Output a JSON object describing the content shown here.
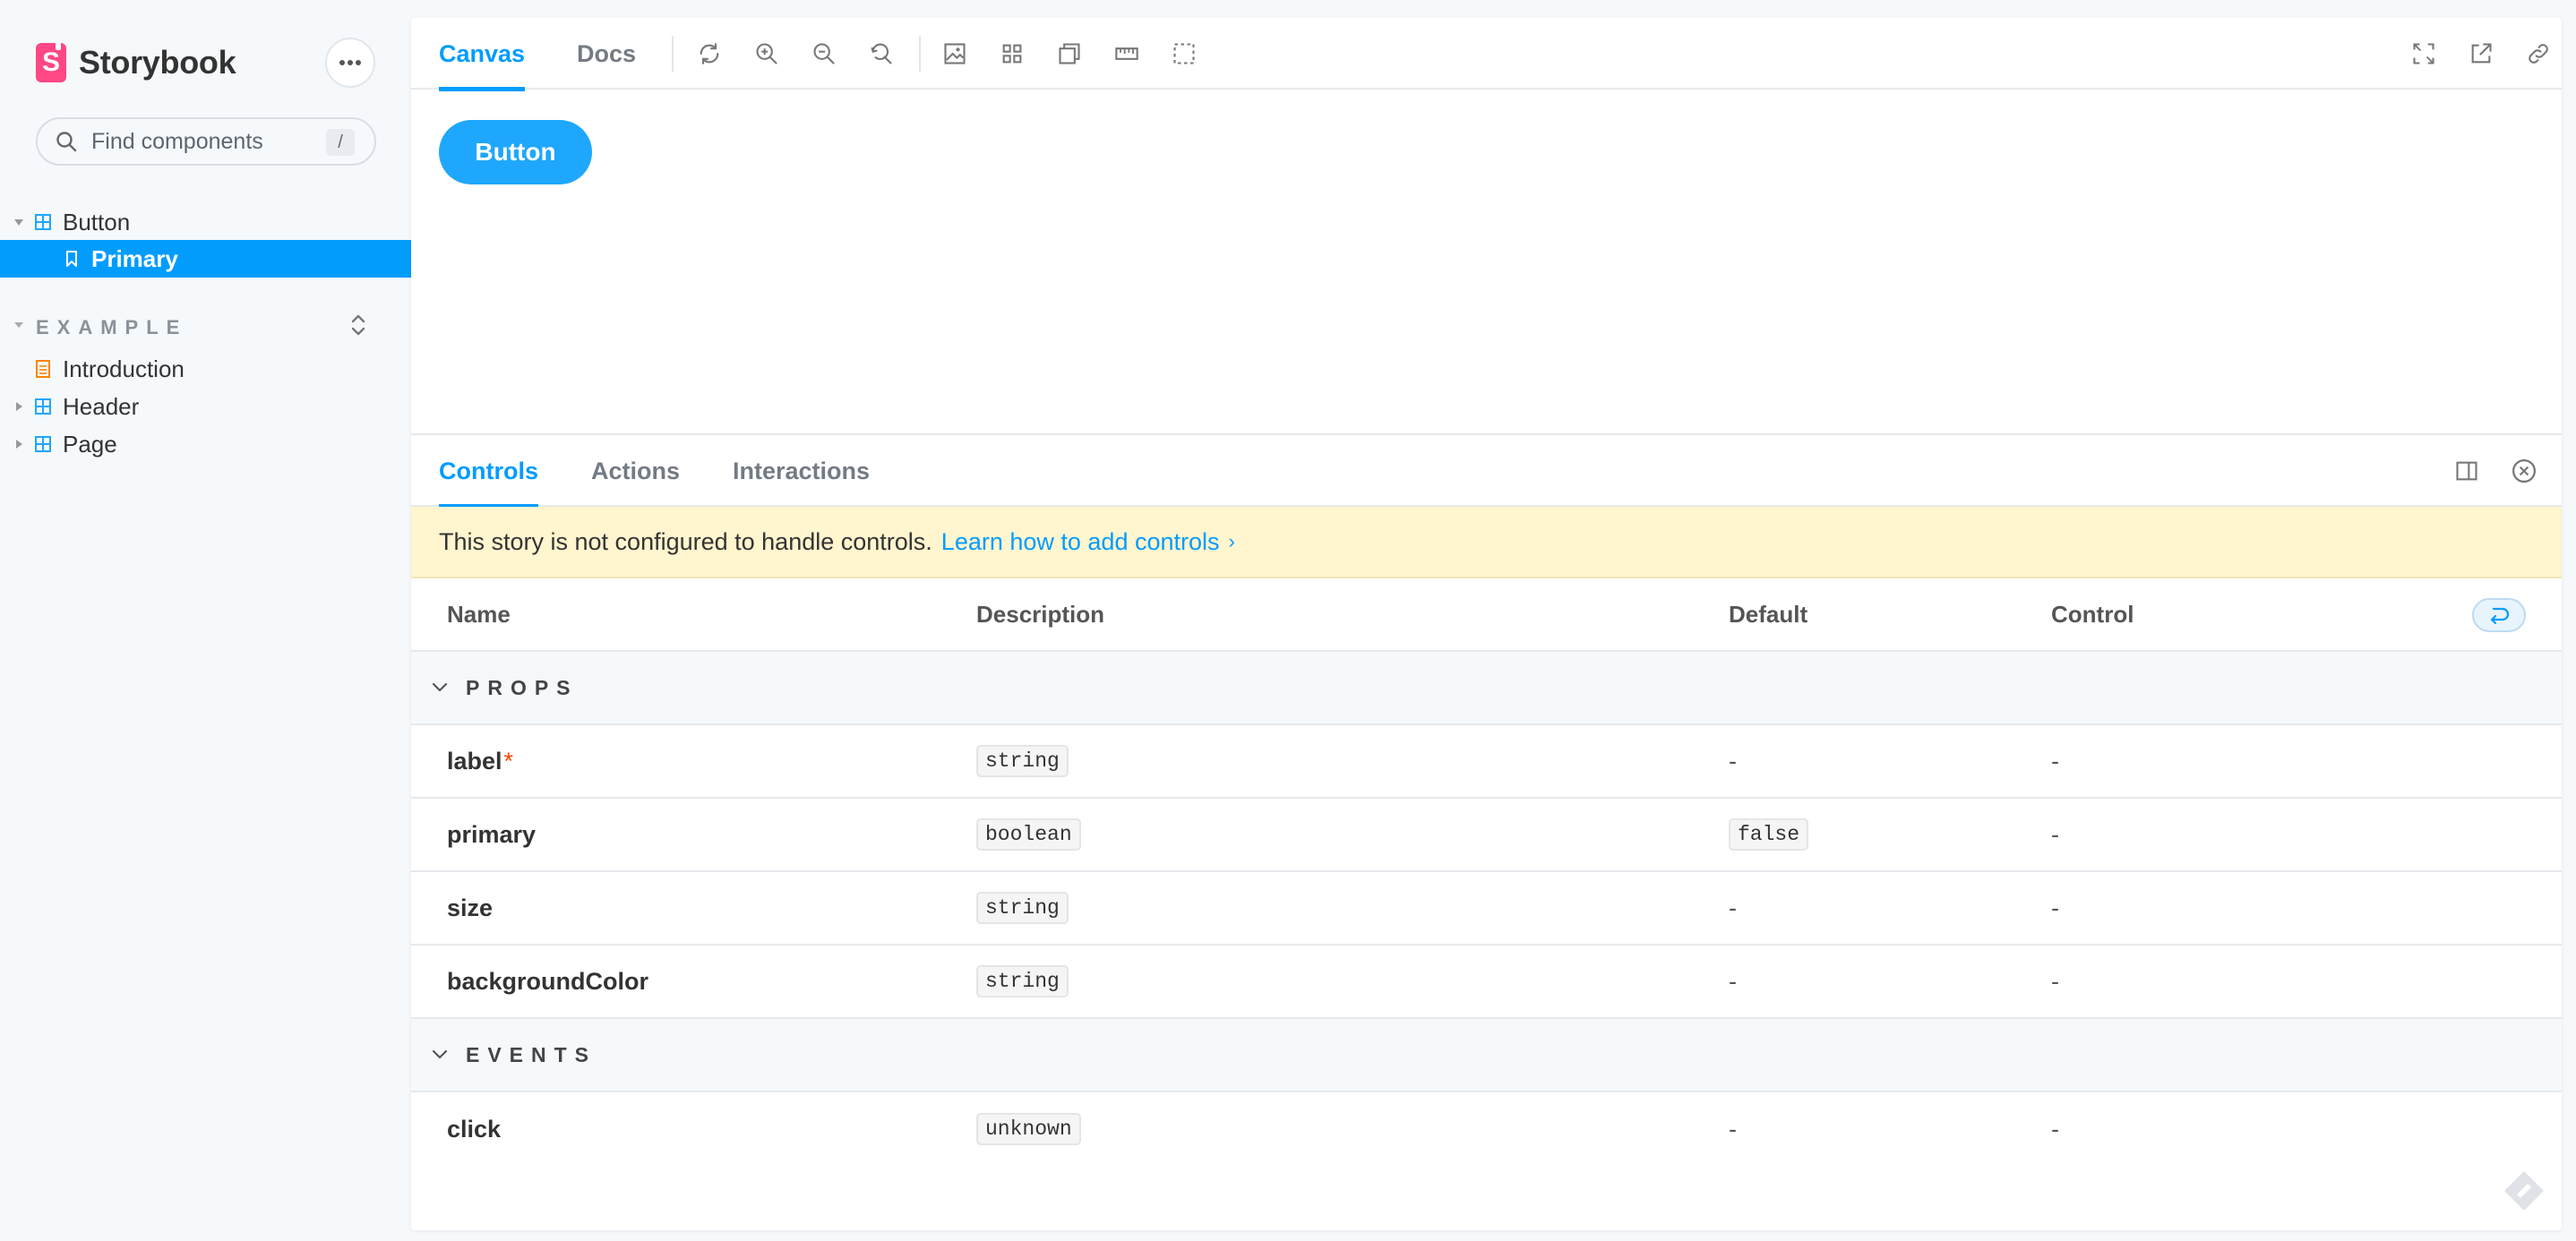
{
  "app": {
    "name": "Storybook",
    "brand_color": "#ff4785",
    "accent_color": "#029cfd"
  },
  "sidebar": {
    "search_placeholder": "Find components",
    "search_shortcut": "/",
    "tree": [
      {
        "label": "Button",
        "icon": "component-icon",
        "expanded": true
      },
      {
        "label": "Primary",
        "icon": "bookmark-icon",
        "selected": true
      }
    ],
    "section": {
      "title": "EXAMPLE",
      "items": [
        {
          "label": "Introduction",
          "icon": "document-icon"
        },
        {
          "label": "Header",
          "icon": "component-icon"
        },
        {
          "label": "Page",
          "icon": "component-icon"
        }
      ]
    }
  },
  "toolbar": {
    "tabs": [
      "Canvas",
      "Docs"
    ],
    "active_tab": "Canvas"
  },
  "preview": {
    "button_label": "Button",
    "button_color": "#1ea7fd"
  },
  "addons": {
    "tabs": [
      "Controls",
      "Actions",
      "Interactions"
    ],
    "active_tab": "Controls"
  },
  "notice": {
    "text": "This story is not configured to handle controls.",
    "link": "Learn how to add controls"
  },
  "table": {
    "headers": [
      "Name",
      "Description",
      "Default",
      "Control"
    ],
    "groups": [
      {
        "title": "PROPS",
        "rows": [
          {
            "name": "label",
            "required": "*",
            "type": "string",
            "default": "-",
            "control": "-"
          },
          {
            "name": "primary",
            "type": "boolean",
            "default": "false",
            "control": "-"
          },
          {
            "name": "size",
            "type": "string",
            "default": "-",
            "control": "-"
          },
          {
            "name": "backgroundColor",
            "type": "string",
            "default": "-",
            "control": "-"
          }
        ]
      },
      {
        "title": "EVENTS",
        "rows": [
          {
            "name": "click",
            "type": "unknown",
            "default": "-",
            "control": "-"
          }
        ]
      }
    ]
  }
}
